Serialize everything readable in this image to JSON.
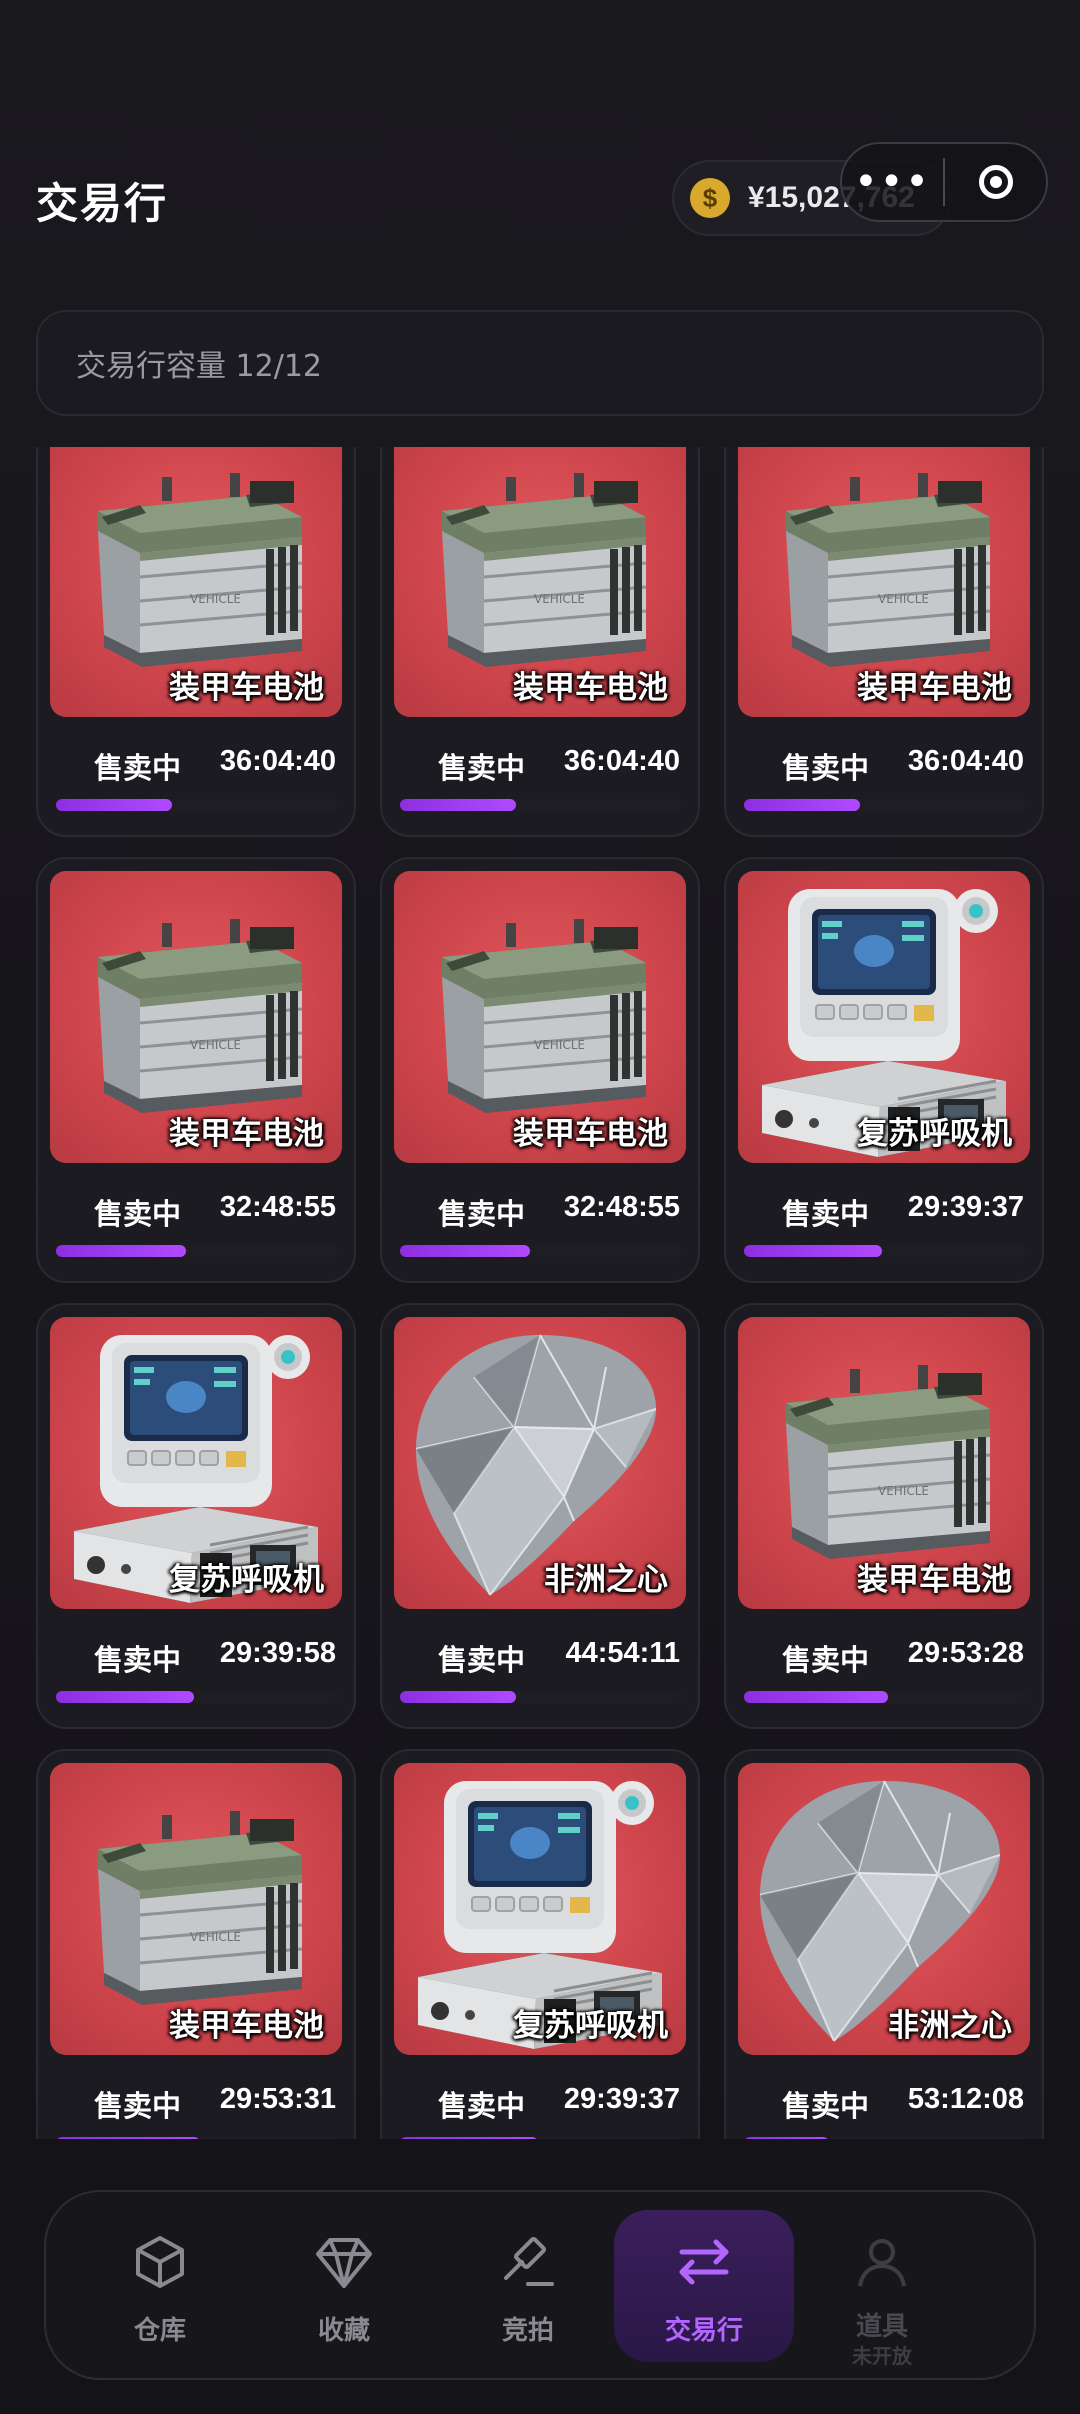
{
  "header": {
    "title": "交易行",
    "balance": "¥15,027,762",
    "coin_symbol": "$",
    "more_icon": "ellipsis-icon",
    "target_icon": "target-icon"
  },
  "capacity": {
    "label": "交易行容量 12/12"
  },
  "listings": [
    {
      "name": "装甲车电池",
      "status": "售卖中",
      "time": "36:04:40",
      "progress": 0.41,
      "item": "battery"
    },
    {
      "name": "装甲车电池",
      "status": "售卖中",
      "time": "36:04:40",
      "progress": 0.41,
      "item": "battery"
    },
    {
      "name": "装甲车电池",
      "status": "售卖中",
      "time": "36:04:40",
      "progress": 0.41,
      "item": "battery"
    },
    {
      "name": "装甲车电池",
      "status": "售卖中",
      "time": "32:48:55",
      "progress": 0.46,
      "item": "battery"
    },
    {
      "name": "装甲车电池",
      "status": "售卖中",
      "time": "32:48:55",
      "progress": 0.46,
      "item": "battery"
    },
    {
      "name": "复苏呼吸机",
      "status": "售卖中",
      "time": "29:39:37",
      "progress": 0.49,
      "item": "ventilator"
    },
    {
      "name": "复苏呼吸机",
      "status": "售卖中",
      "time": "29:39:58",
      "progress": 0.49,
      "item": "ventilator"
    },
    {
      "name": "非洲之心",
      "status": "售卖中",
      "time": "44:54:11",
      "progress": 0.41,
      "item": "diamond"
    },
    {
      "name": "装甲车电池",
      "status": "售卖中",
      "time": "29:53:28",
      "progress": 0.51,
      "item": "battery"
    },
    {
      "name": "装甲车电池",
      "status": "售卖中",
      "time": "29:53:31",
      "progress": 0.51,
      "item": "battery"
    },
    {
      "name": "复苏呼吸机",
      "status": "售卖中",
      "time": "29:39:37",
      "progress": 0.49,
      "item": "ventilator"
    },
    {
      "name": "非洲之心",
      "status": "售卖中",
      "time": "53:12:08",
      "progress": 0.3,
      "item": "diamond"
    }
  ],
  "tabs": [
    {
      "label": "仓库",
      "icon": "box-icon",
      "active": false
    },
    {
      "label": "收藏",
      "icon": "diamond-icon",
      "active": false
    },
    {
      "label": "竞拍",
      "icon": "gavel-icon",
      "active": false
    },
    {
      "label": "交易行",
      "icon": "swap-arrows-icon",
      "active": true
    },
    {
      "label": "道具",
      "sub": "未开放",
      "icon": "person-icon",
      "active": false,
      "disabled": true
    }
  ],
  "colors": {
    "accent": "#b266ff",
    "card_bg": "#cf454c",
    "progress": "#9a3bf0",
    "coin": "#d8a92c"
  }
}
